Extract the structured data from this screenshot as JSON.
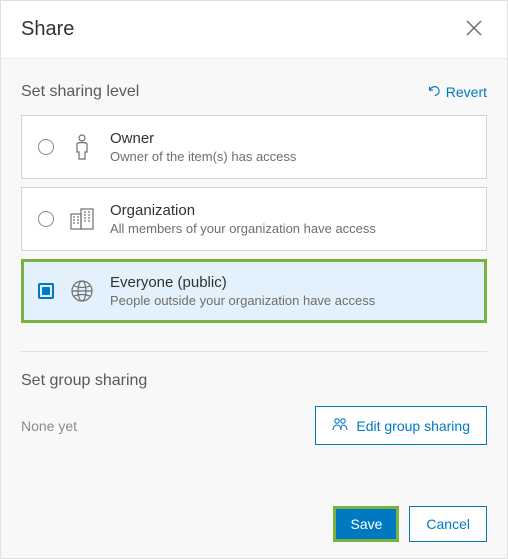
{
  "header": {
    "title": "Share"
  },
  "sharingLevel": {
    "title": "Set sharing level",
    "revert": "Revert",
    "selectedIndex": 2,
    "options": [
      {
        "title": "Owner",
        "desc": "Owner of the item(s) has access",
        "icon": "owner-icon"
      },
      {
        "title": "Organization",
        "desc": "All members of your organization have access",
        "icon": "organization-icon"
      },
      {
        "title": "Everyone (public)",
        "desc": "People outside your organization have access",
        "icon": "globe-icon"
      }
    ]
  },
  "groupSharing": {
    "title": "Set group sharing",
    "none": "None yet",
    "editButton": "Edit group sharing"
  },
  "footer": {
    "save": "Save",
    "cancel": "Cancel"
  }
}
